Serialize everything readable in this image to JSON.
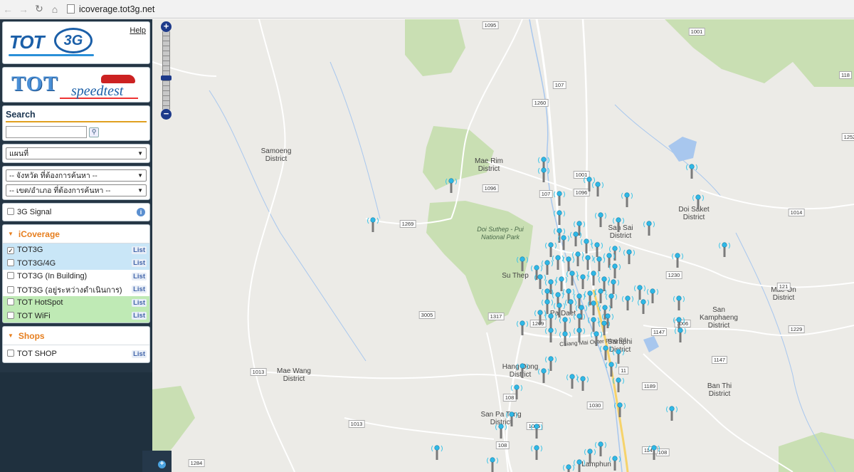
{
  "browser": {
    "url": "icoverage.tot3g.net",
    "back_icon": "arrow-left-icon",
    "forward_icon": "arrow-right-icon",
    "reload_icon": "reload-icon",
    "home_icon": "home-icon"
  },
  "sidebar": {
    "logo_tot": "TOT",
    "logo_3g": "3G",
    "help": "Help",
    "speedtest_tot": "TOT",
    "speedtest_text": "speedtest",
    "search": {
      "title": "Search",
      "value": "",
      "button_icon": "search-icon"
    },
    "map_type": "แผนที่",
    "province_select": "-- จังหวัด ที่ต้องการค้นหา --",
    "district_select": "-- เขต/อำเภอ ที่ต้องการค้นหา --",
    "signal": {
      "label": "3G Signal",
      "checked": false
    },
    "icoverage": {
      "title": "iCoverage",
      "layers": [
        {
          "label": "TOT3G",
          "checked": true,
          "list": "List",
          "tone": "blue"
        },
        {
          "label": "TOT3G/4G",
          "checked": false,
          "list": "List",
          "tone": "blue"
        },
        {
          "label": "TOT3G (In Building)",
          "checked": false,
          "list": "List",
          "tone": "white"
        },
        {
          "label": "TOT3G (อยู่ระหว่างดำเนินการ)",
          "checked": false,
          "list": "List",
          "tone": "white"
        },
        {
          "label": "TOT HotSpot",
          "checked": false,
          "list": "List",
          "tone": "green"
        },
        {
          "label": "TOT WiFi",
          "checked": false,
          "list": "List",
          "tone": "green"
        }
      ]
    },
    "shops": {
      "title": "Shops",
      "items": [
        {
          "label": "TOT SHOP",
          "checked": false,
          "list": "List"
        }
      ]
    }
  },
  "map": {
    "zoom_in": "+",
    "zoom_out": "−",
    "labels": [
      {
        "text": "Samoeng",
        "text2": "District"
      },
      {
        "text": "Mae Rim",
        "text2": "District"
      },
      {
        "text": "Doi Suthep - Pui",
        "text2": "National Park"
      },
      {
        "text": "Su Thep",
        "text2": ""
      },
      {
        "text": "San Sai",
        "text2": "District"
      },
      {
        "text": "Doi Saket",
        "text2": "District"
      },
      {
        "text": "Mae On",
        "text2": "District"
      },
      {
        "text": "San",
        "text2": "Kamphaeng",
        "text3": "District"
      },
      {
        "text": "Pa Daet",
        "text2": ""
      },
      {
        "text": "Saraphi",
        "text2": "District"
      },
      {
        "text": "Hang Dong",
        "text2": "District"
      },
      {
        "text": "Mae Wang",
        "text2": "District"
      },
      {
        "text": "San Pa Tong",
        "text2": "District"
      },
      {
        "text": "Ban Thi",
        "text2": "District"
      },
      {
        "text": "Chiang Mai Outer Ring Rd",
        "text2": ""
      },
      {
        "text": "Lamphun",
        "text2": ""
      }
    ],
    "roads": [
      "1095",
      "1001",
      "107",
      "1260",
      "1001",
      "1096",
      "107",
      "1096",
      "1269",
      "3005",
      "1014",
      "1230",
      "121",
      "1269",
      "1317",
      "1147",
      "1006",
      "1229",
      "1147",
      "1013",
      "108",
      "1189",
      "1030",
      "108",
      "1013",
      "1015",
      "108",
      "1147",
      "1284",
      "118",
      "1252",
      "11"
    ],
    "marker_icon": "cell-tower-icon"
  }
}
